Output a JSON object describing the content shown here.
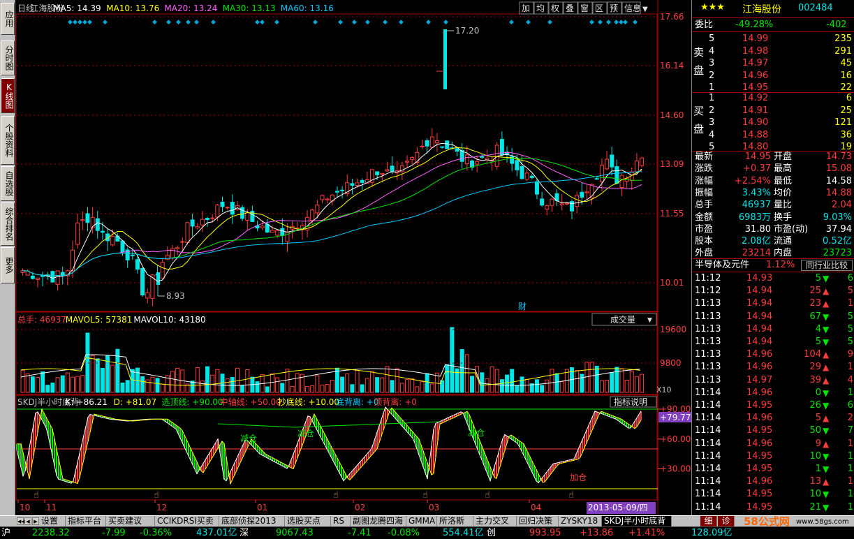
{
  "sidebar": {
    "items": [
      "应用",
      "分时图",
      "K线图",
      "个股资料",
      "自选股",
      "综合排名",
      "更多"
    ],
    "active": 2
  },
  "kline": {
    "period": "日线",
    "stock": "江海股份",
    "ma": [
      {
        "label": "MA5:",
        "value": "14.39",
        "color": "#ffffff"
      },
      {
        "label": "MA10:",
        "value": "13.76",
        "color": "#ffff00"
      },
      {
        "label": "MA20:",
        "value": "13.24",
        "color": "#ff60ff"
      },
      {
        "label": "MA30:",
        "value": "13.13",
        "color": "#00e600"
      },
      {
        "label": "MA60:",
        "value": "13.16",
        "color": "#00c8ff"
      }
    ],
    "toolbar": [
      "加",
      "均",
      "权",
      "叠",
      "窗",
      "区",
      "预",
      "信息"
    ],
    "price_axis": [
      "17.66",
      "16.14",
      "14.60",
      "13.09",
      "11.55",
      "10.01"
    ],
    "high_label": "17.20",
    "low_label": "8.93",
    "cai_mark": "财"
  },
  "volume": {
    "total_label": "总手:",
    "total": "46937",
    "mavol5_label": "MAVOL5:",
    "mavol5": "57381",
    "mavol10_label": "MAVOL10:",
    "mavol10": "43180",
    "dropdown": "成交量",
    "axis": [
      "19600",
      "9800"
    ],
    "unit": "X10"
  },
  "indicator": {
    "name": "SKDJ半小时底背",
    "k_label": "K:",
    "k": "+86.21",
    "d_label": "D:",
    "d": "+81.07",
    "xuanding_label": "选顶线:",
    "xuanding": "+90.00",
    "zhouxian_label": "中轴线:",
    "zhouxian": "+50.00",
    "chaodi_label": "抄底线:",
    "chaodi": "+10.00",
    "dibei_label": "底背离:",
    "dibei": "+0",
    "dingbei_label": "顶背离:",
    "dingbei": "+0",
    "help": "指标说明",
    "axis": [
      "+90.00",
      "+60.00",
      "+30.00"
    ],
    "current": "+79.77",
    "labels": [
      "减仓",
      "减仓",
      "减仓",
      "加仓"
    ]
  },
  "date_axis": [
    "10",
    "11",
    "12",
    "01",
    "02",
    "03",
    "04"
  ],
  "current_date": "2013-05-09/四",
  "quote": {
    "stars": "★★★",
    "name": "江海股份",
    "code": "002484",
    "weibi_label": "委比",
    "weibi": "-49.28%",
    "weicha": "-402",
    "sell_label": "卖盘",
    "buy_label": "买盘",
    "sell": [
      {
        "level": "5",
        "price": "14.99",
        "vol": "235"
      },
      {
        "level": "4",
        "price": "14.98",
        "vol": "291"
      },
      {
        "level": "3",
        "price": "14.97",
        "vol": "45"
      },
      {
        "level": "2",
        "price": "14.96",
        "vol": "16"
      },
      {
        "level": "1",
        "price": "14.95",
        "vol": "22"
      }
    ],
    "buy": [
      {
        "level": "1",
        "price": "14.92",
        "vol": "6"
      },
      {
        "level": "2",
        "price": "14.91",
        "vol": "25"
      },
      {
        "level": "3",
        "price": "14.90",
        "vol": "121"
      },
      {
        "level": "4",
        "price": "14.88",
        "vol": "36"
      },
      {
        "level": "5",
        "price": "14.80",
        "vol": "19"
      }
    ],
    "stats": [
      {
        "l1": "最新",
        "v1": "14.95",
        "c1": "red",
        "l2": "开盘",
        "v2": "14.73",
        "c2": "red"
      },
      {
        "l1": "涨跌",
        "v1": "+0.37",
        "c1": "red",
        "l2": "最高",
        "v2": "15.08",
        "c2": "red"
      },
      {
        "l1": "涨幅",
        "v1": "+2.54%",
        "c1": "red",
        "l2": "最低",
        "v2": "14.58",
        "c2": "wht"
      },
      {
        "l1": "振幅",
        "v1": "3.43%",
        "c1": "cyn",
        "l2": "均价",
        "v2": "14.88",
        "c2": "red"
      },
      {
        "l1": "总手",
        "v1": "46937",
        "c1": "cyn",
        "l2": "量比",
        "v2": "2.04",
        "c2": "red"
      },
      {
        "l1": "金额",
        "v1": "6983万",
        "c1": "cyn",
        "l2": "换手",
        "v2": "9.03%",
        "c2": "cyn"
      },
      {
        "l1": "市盈",
        "v1": "31.80",
        "c1": "wht",
        "l2": "市盈(动)",
        "v2": "37.94",
        "c2": "wht"
      },
      {
        "l1": "股本",
        "v1": "2.08亿",
        "c1": "cyn",
        "l2": "流通",
        "v2": "0.52亿",
        "c2": "cyn"
      },
      {
        "l1": "外盘",
        "v1": "23214",
        "c1": "red",
        "l2": "内盘",
        "v2": "23723",
        "c2": "grn"
      }
    ],
    "sector": "半导体及元件",
    "sector_pct": "1.12%",
    "compare_btn": "同行业比较"
  },
  "ticks": [
    {
      "t": "11:12",
      "p": "14.93",
      "v": "5",
      "d": "down"
    },
    {
      "t": "11:12",
      "p": "14.94",
      "v": "25",
      "d": "up"
    },
    {
      "t": "11:13",
      "p": "14.94",
      "v": "23",
      "d": "up"
    },
    {
      "t": "11:13",
      "p": "14.94",
      "v": "67",
      "d": "down"
    },
    {
      "t": "11:13",
      "p": "14.94",
      "v": "4",
      "d": "down"
    },
    {
      "t": "11:13",
      "p": "14.94",
      "v": "5",
      "d": "down"
    },
    {
      "t": "11:13",
      "p": "14.96",
      "v": "104",
      "d": "up"
    },
    {
      "t": "11:13",
      "p": "14.96",
      "v": "29",
      "d": "up"
    },
    {
      "t": "11:13",
      "p": "14.97",
      "v": "39",
      "d": "up"
    },
    {
      "t": "11:14",
      "p": "14.96",
      "v": "0",
      "d": "down"
    },
    {
      "t": "11:14",
      "p": "14.95",
      "v": "26",
      "d": "down"
    },
    {
      "t": "11:14",
      "p": "14.96",
      "v": "5",
      "d": "up"
    },
    {
      "t": "11:14",
      "p": "14.95",
      "v": "50",
      "d": "down"
    },
    {
      "t": "11:14",
      "p": "14.96",
      "v": "9",
      "d": "up"
    },
    {
      "t": "11:14",
      "p": "14.95",
      "v": "10",
      "d": "down"
    },
    {
      "t": "11:14",
      "p": "14.95",
      "v": "1",
      "d": "down"
    },
    {
      "t": "11:14",
      "p": "14.96",
      "v": "13",
      "d": "up"
    },
    {
      "t": "11:14",
      "p": "14.95",
      "v": "10",
      "d": "down"
    },
    {
      "t": "11:14",
      "p": "14.95",
      "v": "21",
      "d": "down"
    }
  ],
  "tick_tail": [
    "6",
    "5",
    "1",
    "5",
    "5",
    "5",
    "9",
    "1",
    "4",
    "1",
    "6",
    "2",
    "7",
    "1",
    "1",
    "1",
    "1",
    "1",
    "1"
  ],
  "tabs": [
    "设置",
    "指标平台",
    "买卖建议",
    "CCIKDRSI买卖",
    "底部侦探2013",
    "选股买点",
    "RS",
    "副图龙腾四海",
    "GMMA",
    "所洛斯",
    "主力交叉",
    "回归决策",
    "ZYSKY18",
    "SKDJ半小时底背"
  ],
  "detail_tabs": [
    "细",
    "诊"
  ],
  "watermark": "58公式网",
  "watermark_url": "www.58gs.com",
  "status": {
    "sh_label": "沪",
    "sh": "2238.32",
    "sh_chg": "-7.99",
    "sh_pct": "-0.36%",
    "sh_amt": "437.01亿",
    "sz_label": "深",
    "sz": "9067.43",
    "sz_chg": "-7.41",
    "sz_pct": "-0.08%",
    "sz_amt": "554.41亿",
    "cy_label": "创",
    "cy": "993.95",
    "cy_chg": "+13.86",
    "cy_pct": "+1.41%",
    "cy_amt": "128.09亿"
  }
}
